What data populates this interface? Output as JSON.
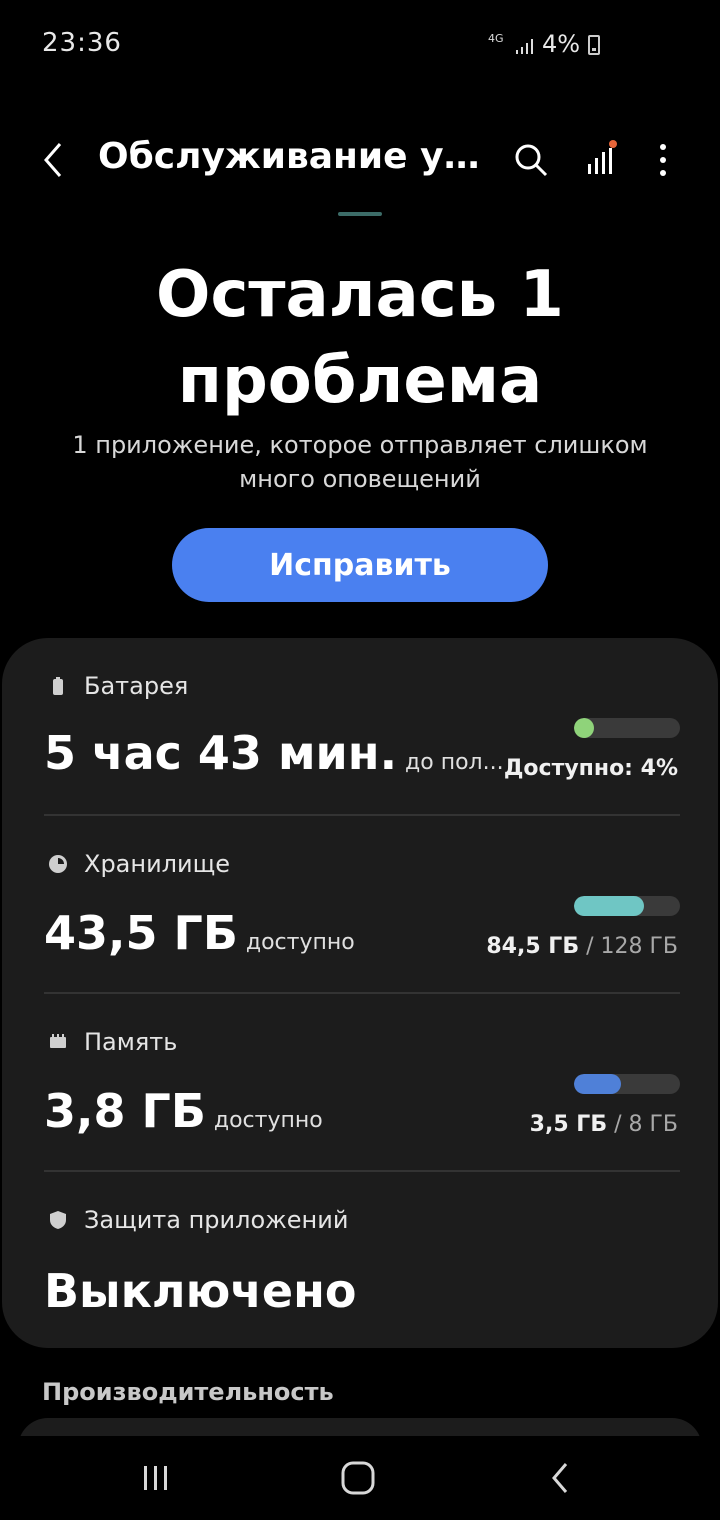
{
  "status_bar": {
    "time": "23:36",
    "network": "4G",
    "battery_percent": "4%"
  },
  "app_bar": {
    "title": "Обслуживание уст...",
    "icons": [
      "back-icon",
      "search-icon",
      "stats-icon",
      "more-icon"
    ],
    "notification_dot_color": "#e8663a"
  },
  "hero": {
    "title_line1": "Осталась 1",
    "title_line2": "проблема",
    "subtitle_line1": "1 приложение, которое отправляет слишком",
    "subtitle_line2": "много оповещений",
    "fix_button": "Исправить"
  },
  "battery": {
    "label": "Батарея",
    "value": "5 час 43 мин.",
    "value_suffix": "до пол...",
    "available": "Доступно: 4%",
    "level_fraction": 0.04,
    "color": "#8fd37a"
  },
  "storage": {
    "label": "Хранилище",
    "value": "43,5 ГБ",
    "value_suffix": "доступно",
    "used": "84,5 ГБ",
    "total": "128 ГБ",
    "used_fraction": 0.66,
    "color": "#6fc6c4"
  },
  "memory": {
    "label": "Память",
    "value": "3,8 ГБ",
    "value_suffix": "доступно",
    "used": "3,5 ГБ",
    "total": "8 ГБ",
    "used_fraction": 0.44,
    "color": "#4f80d8"
  },
  "app_protection": {
    "label": "Защита приложений",
    "value": "Выключено"
  },
  "performance": {
    "heading": "Производительность"
  },
  "nav": {
    "icons": [
      "recents-icon",
      "home-icon",
      "back-nav-icon"
    ]
  }
}
